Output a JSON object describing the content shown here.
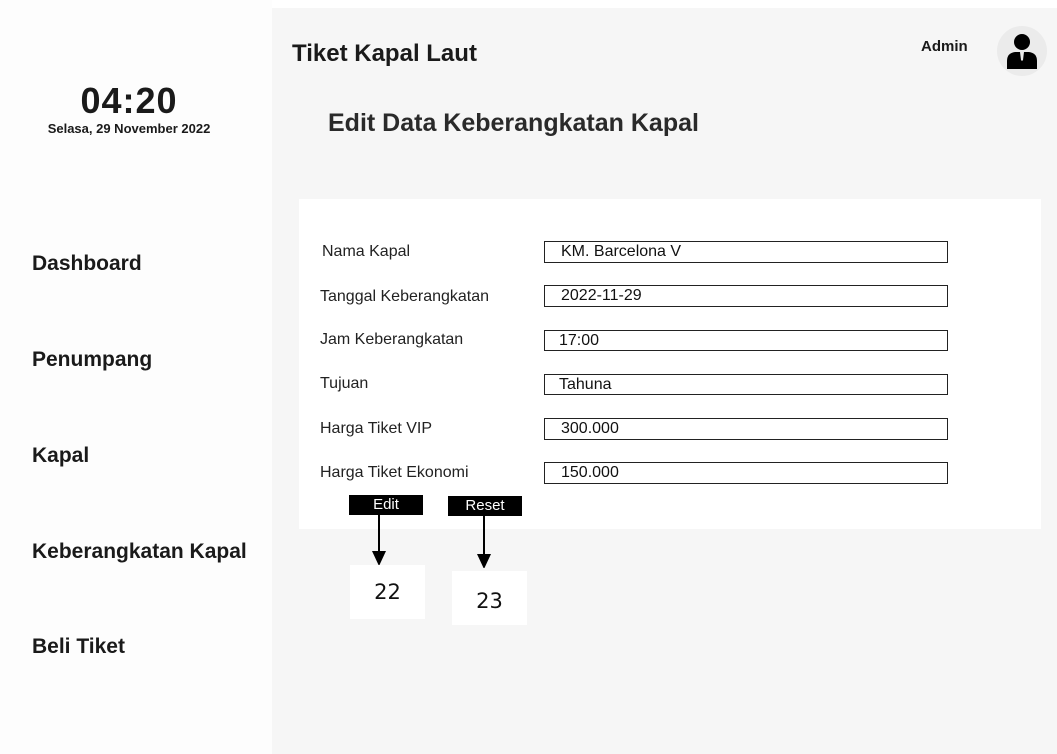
{
  "clock": {
    "time": "04:20",
    "date": "Selasa, 29 November 2022"
  },
  "sidebar": {
    "items": [
      {
        "label": "Dashboard"
      },
      {
        "label": "Penumpang"
      },
      {
        "label": "Kapal"
      },
      {
        "label": "Keberangkatan Kapal"
      },
      {
        "label": "Beli Tiket"
      }
    ]
  },
  "header": {
    "app_title": "Tiket Kapal Laut",
    "user_label": "Admin",
    "avatar_icon": "user-icon"
  },
  "page": {
    "title": "Edit Data Keberangkatan Kapal"
  },
  "form": {
    "fields": [
      {
        "label": "Nama Kapal",
        "value": "KM. Barcelona V"
      },
      {
        "label": "Tanggal Keberangkatan",
        "value": "2022-11-29"
      },
      {
        "label": "Jam Keberangkatan",
        "value": "17:00"
      },
      {
        "label": "Tujuan",
        "value": "Tahuna"
      },
      {
        "label": "Harga Tiket VIP",
        "value": "300.000"
      },
      {
        "label": "Harga Tiket Ekonomi",
        "value": "150.000"
      }
    ],
    "edit_label": "Edit",
    "reset_label": "Reset"
  },
  "annotations": {
    "edit_number": "22",
    "reset_number": "23"
  }
}
